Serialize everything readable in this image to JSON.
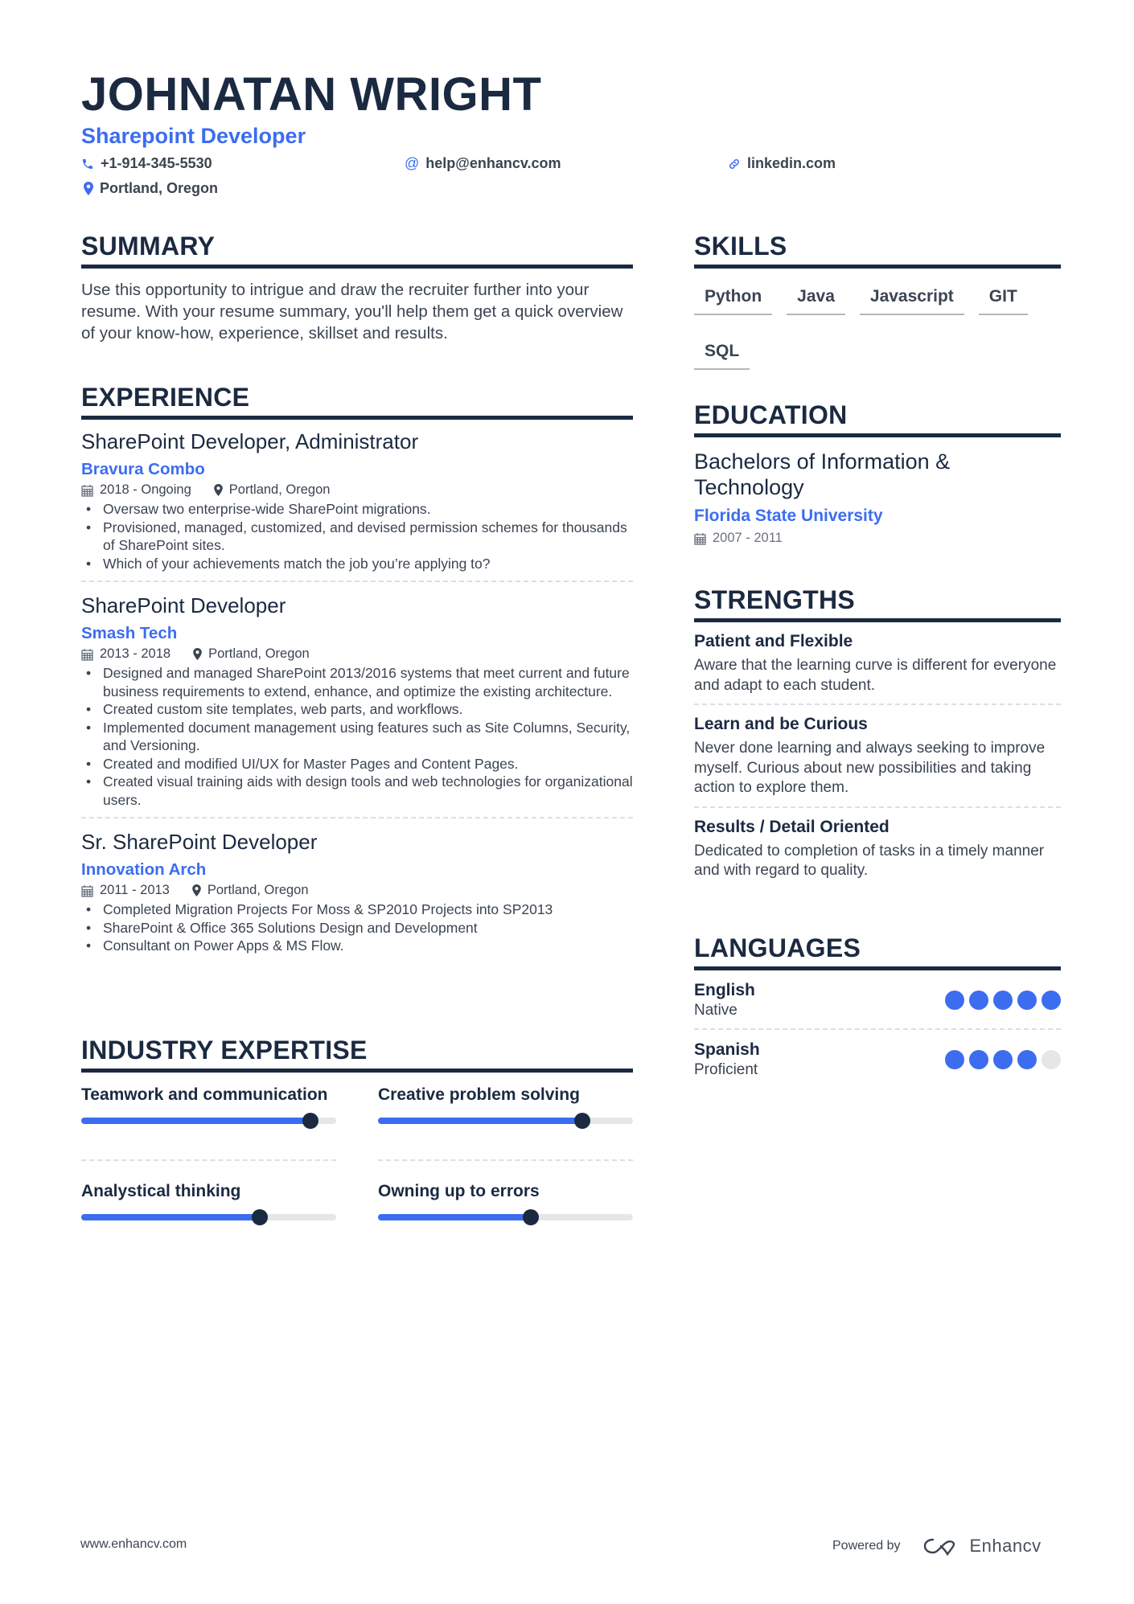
{
  "header": {
    "name": "JOHNATAN WRIGHT",
    "title": "Sharepoint Developer",
    "phone": "+1-914-345-5530",
    "email": "help@enhancv.com",
    "linkedin": "linkedin.com",
    "location": "Portland, Oregon"
  },
  "summary": {
    "title": "SUMMARY",
    "text": "Use this opportunity to intrigue and draw the recruiter further into your resume. With your resume summary, you'll help them get a quick overview of your know-how, experience, skillset and results."
  },
  "experience": {
    "title": "EXPERIENCE",
    "jobs": [
      {
        "title": "SharePoint Developer, Administrator",
        "company": "Bravura Combo",
        "dates": "2018 - Ongoing",
        "location": "Portland, Oregon",
        "bullets": [
          "Oversaw two enterprise-wide SharePoint migrations.",
          "Provisioned, managed, customized, and devised permission schemes for thousands of SharePoint sites.",
          "Which of your achievements match the job you’re applying to?"
        ]
      },
      {
        "title": "SharePoint Developer",
        "company": "Smash Tech",
        "dates": "2013 - 2018",
        "location": "Portland, Oregon",
        "bullets": [
          "Designed and managed SharePoint 2013/2016 systems that meet current and future business requirements to extend, enhance, and optimize the existing architecture.",
          "Created custom site templates, web parts, and workflows.",
          "Implemented document management using features such as Site Columns, Security, and Versioning.",
          "Created and modified UI/UX for Master Pages and Content Pages.",
          "Created visual training aids with design tools and web technologies for organizational users."
        ]
      },
      {
        "title": "Sr. SharePoint Developer",
        "company": "Innovation Arch",
        "dates": "2011 - 2013",
        "location": "Portland, Oregon",
        "bullets": [
          "Completed Migration Projects For Moss & SP2010 Projects into SP2013",
          "SharePoint & Office 365 Solutions Design and Development",
          "Consultant on Power Apps & MS Flow."
        ]
      }
    ]
  },
  "expertise": {
    "title": "INDUSTRY EXPERTISE",
    "items": [
      {
        "label": "Teamwork and communication",
        "level_percent": 90
      },
      {
        "label": "Creative problem solving",
        "level_percent": 80
      },
      {
        "label": "Analystical thinking",
        "level_percent": 70
      },
      {
        "label": "Owning up to errors",
        "level_percent": 60
      }
    ]
  },
  "skills": {
    "title": "SKILLS",
    "items": [
      "Python",
      "Java",
      "Javascript",
      "GIT",
      "SQL"
    ]
  },
  "education": {
    "title": "EDUCATION",
    "degree": "Bachelors of Information & Technology",
    "school": "Florida State University",
    "dates": "2007 - 2011"
  },
  "strengths": {
    "title": "STRENGTHS",
    "items": [
      {
        "title": "Patient and Flexible",
        "desc": "Aware that the learning curve is different for everyone and adapt to each student."
      },
      {
        "title": "Learn and be Curious",
        "desc": "Never done learning and always seeking to improve myself. Curious about new possibilities and taking action to explore them."
      },
      {
        "title": "Results / Detail Oriented",
        "desc": "Dedicated to completion of tasks in a timely manner and with regard to quality."
      }
    ]
  },
  "languages": {
    "title": "LANGUAGES",
    "items": [
      {
        "name": "English",
        "level": "Native",
        "rating": 5,
        "max": 5
      },
      {
        "name": "Spanish",
        "level": "Proficient",
        "rating": 4,
        "max": 5
      }
    ]
  },
  "footer": {
    "url": "www.enhancv.com",
    "powered_by": "Powered by",
    "brand": "Enhancv"
  },
  "colors": {
    "accent": "#3c6df0",
    "heading": "#1b2a41",
    "text": "#3b4452"
  }
}
